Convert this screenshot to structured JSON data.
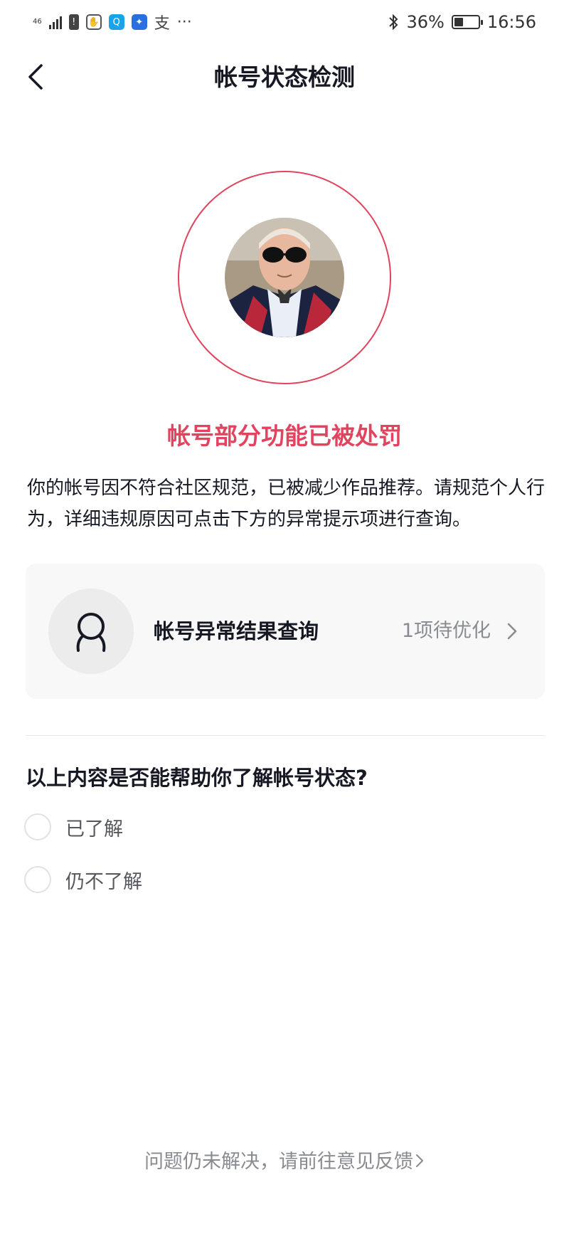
{
  "status_bar": {
    "network": "46",
    "network_sub": "ılll",
    "app_text": "支",
    "more": "···",
    "battery": "36%",
    "time": "16:56"
  },
  "nav": {
    "title": "帐号状态检测",
    "back_icon": "chevron-left-icon"
  },
  "profile": {
    "avatar_icon": "user-avatar",
    "ring_color": "#e0445f"
  },
  "status": {
    "title": "帐号部分功能已被处罚",
    "description": "你的帐号因不符合社区规范，已被减少作品推荐。请规范个人行为，详细违规原因可点击下方的异常提示项进行查询。"
  },
  "card": {
    "icon": "person-icon",
    "title": "帐号异常结果查询",
    "status": "1项待优化"
  },
  "survey": {
    "question": "以上内容是否能帮助你了解帐号状态?",
    "options": [
      "已了解",
      "仍不了解"
    ]
  },
  "footer": {
    "feedback": "问题仍未解决，请前往意见反馈"
  },
  "colors": {
    "accent": "#e0445f",
    "text": "#161823",
    "muted": "#8a8b91"
  }
}
